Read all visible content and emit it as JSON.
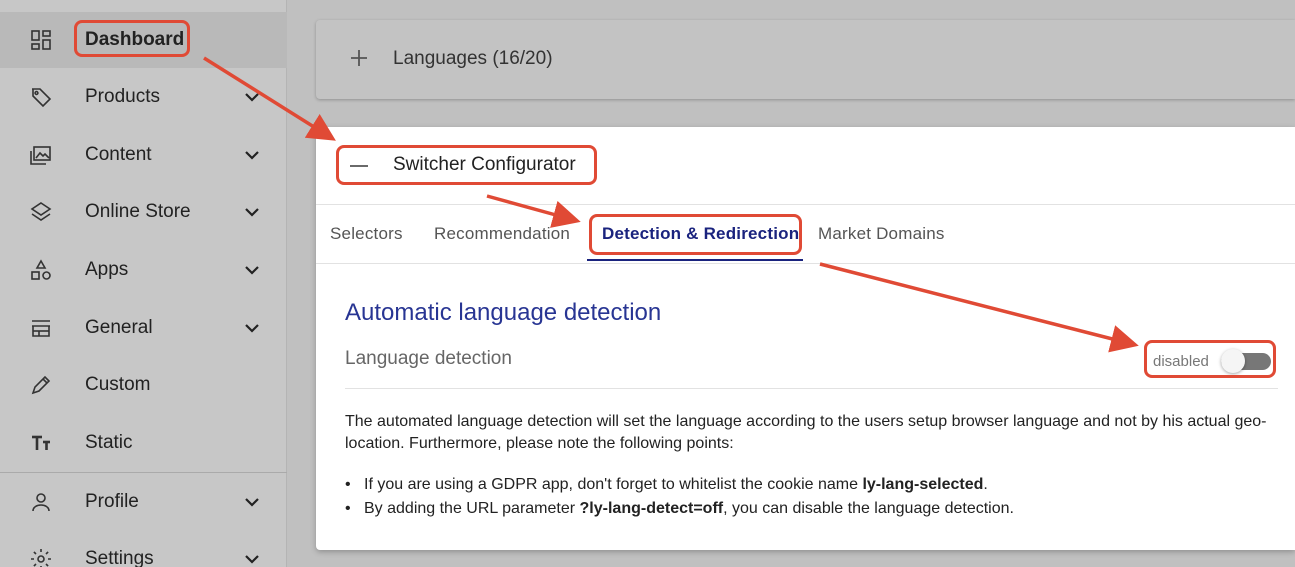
{
  "sidebar": {
    "items": [
      {
        "label": "Dashboard",
        "icon": "dashboard-icon",
        "has_chevron": false
      },
      {
        "label": "Products",
        "icon": "tag-icon",
        "has_chevron": true
      },
      {
        "label": "Content",
        "icon": "images-icon",
        "has_chevron": true
      },
      {
        "label": "Online Store",
        "icon": "layers-icon",
        "has_chevron": true
      },
      {
        "label": "Apps",
        "icon": "shapes-icon",
        "has_chevron": true
      },
      {
        "label": "General",
        "icon": "store-icon",
        "has_chevron": true
      },
      {
        "label": "Custom",
        "icon": "pencil-icon",
        "has_chevron": false
      },
      {
        "label": "Static",
        "icon": "text-size-icon",
        "has_chevron": false
      },
      {
        "label": "Profile",
        "icon": "person-icon",
        "has_chevron": true
      },
      {
        "label": "Settings",
        "icon": "gear-icon",
        "has_chevron": true
      }
    ]
  },
  "languages_panel": {
    "title": "Languages (16/20)",
    "icon": "plus-icon"
  },
  "switcher": {
    "title": "Switcher Configurator",
    "icon": "minus-icon",
    "tabs": [
      {
        "label": "Selectors",
        "active": false
      },
      {
        "label": "Recommendation",
        "active": false
      },
      {
        "label": "Detection & Redirection",
        "active": true
      },
      {
        "label": "Market Domains",
        "active": false
      }
    ],
    "section_title": "Automatic language detection",
    "detection_label": "Language detection",
    "toggle_text": "disabled",
    "toggle_on": false,
    "description": "The automated language detection will set the language according to the users setup browser language and not by his actual geo-location. Furthermore, please note the following points:",
    "bullet1": {
      "text": "If you are using a GDPR app, don't forget to whitelist the cookie name ",
      "bold": "ly-lang-selected",
      "after": "."
    },
    "bullet2": {
      "text": "By adding the URL parameter ",
      "bold": "?ly-lang-detect=off",
      "after": ", you can disable the language detection."
    }
  },
  "colors": {
    "accent": "#1a237e",
    "section_title": "#283593",
    "annotation": "#e04a35",
    "overlay_bg": "#c0c0c0"
  }
}
